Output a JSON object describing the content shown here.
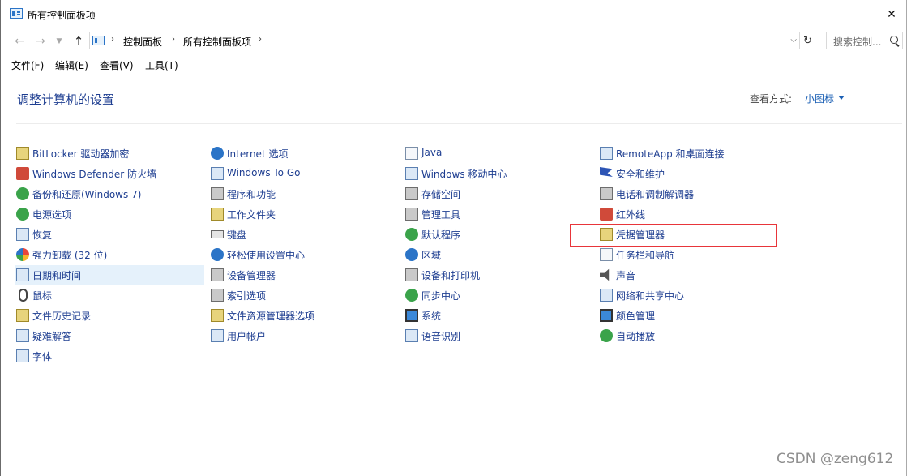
{
  "window": {
    "title": "所有控制面板项"
  },
  "address": {
    "crumbs": [
      "控制面板",
      "所有控制面板项"
    ],
    "search_placeholder": "搜索控制..."
  },
  "menu": [
    "文件(F)",
    "编辑(E)",
    "查看(V)",
    "工具(T)"
  ],
  "content": {
    "heading": "调整计算机的设置",
    "view_by_label": "查看方式:",
    "view_by_value": "小图标"
  },
  "columns": [
    [
      {
        "label": "BitLocker 驱动器加密",
        "icon": "bitlocker-icon"
      },
      {
        "label": "Windows Defender 防火墙",
        "icon": "firewall-icon"
      },
      {
        "label": "备份和还原(Windows 7)",
        "icon": "backup-icon"
      },
      {
        "label": "电源选项",
        "icon": "power-icon"
      },
      {
        "label": "恢复",
        "icon": "recovery-icon"
      },
      {
        "label": "强力卸载 (32 位)",
        "icon": "uninstall-icon"
      },
      {
        "label": "日期和时间",
        "icon": "clock-icon",
        "highlighted": true
      },
      {
        "label": "鼠标",
        "icon": "mouse-icon"
      },
      {
        "label": "文件历史记录",
        "icon": "file-history-icon"
      },
      {
        "label": "疑难解答",
        "icon": "troubleshoot-icon"
      },
      {
        "label": "字体",
        "icon": "fonts-icon"
      }
    ],
    [
      {
        "label": "Internet 选项",
        "icon": "internet-options-icon"
      },
      {
        "label": "Windows To Go",
        "icon": "windows-to-go-icon"
      },
      {
        "label": "程序和功能",
        "icon": "programs-icon"
      },
      {
        "label": "工作文件夹",
        "icon": "work-folders-icon"
      },
      {
        "label": "键盘",
        "icon": "keyboard-icon"
      },
      {
        "label": "轻松使用设置中心",
        "icon": "ease-of-access-icon"
      },
      {
        "label": "设备管理器",
        "icon": "device-manager-icon"
      },
      {
        "label": "索引选项",
        "icon": "indexing-icon"
      },
      {
        "label": "文件资源管理器选项",
        "icon": "explorer-options-icon"
      },
      {
        "label": "用户帐户",
        "icon": "user-accounts-icon"
      }
    ],
    [
      {
        "label": "Java",
        "icon": "java-icon"
      },
      {
        "label": "Windows 移动中心",
        "icon": "mobility-center-icon"
      },
      {
        "label": "存储空间",
        "icon": "storage-spaces-icon"
      },
      {
        "label": "管理工具",
        "icon": "admin-tools-icon"
      },
      {
        "label": "默认程序",
        "icon": "default-programs-icon"
      },
      {
        "label": "区域",
        "icon": "region-icon"
      },
      {
        "label": "设备和打印机",
        "icon": "printer-icon"
      },
      {
        "label": "同步中心",
        "icon": "sync-center-icon"
      },
      {
        "label": "系统",
        "icon": "system-icon"
      },
      {
        "label": "语音识别",
        "icon": "speech-icon"
      }
    ],
    [
      {
        "label": "RemoteApp 和桌面连接",
        "icon": "remoteapp-icon"
      },
      {
        "label": "安全和维护",
        "icon": "security-flag-icon"
      },
      {
        "label": "电话和调制解调器",
        "icon": "phone-modem-icon"
      },
      {
        "label": "红外线",
        "icon": "infrared-icon"
      },
      {
        "label": "凭据管理器",
        "icon": "credential-manager-icon",
        "annotated": true
      },
      {
        "label": "任务栏和导航",
        "icon": "taskbar-icon"
      },
      {
        "label": "声音",
        "icon": "sound-icon"
      },
      {
        "label": "网络和共享中心",
        "icon": "network-icon"
      },
      {
        "label": "颜色管理",
        "icon": "color-management-icon"
      },
      {
        "label": "自动播放",
        "icon": "autoplay-icon"
      }
    ]
  ],
  "watermark": "CSDN @zeng612"
}
